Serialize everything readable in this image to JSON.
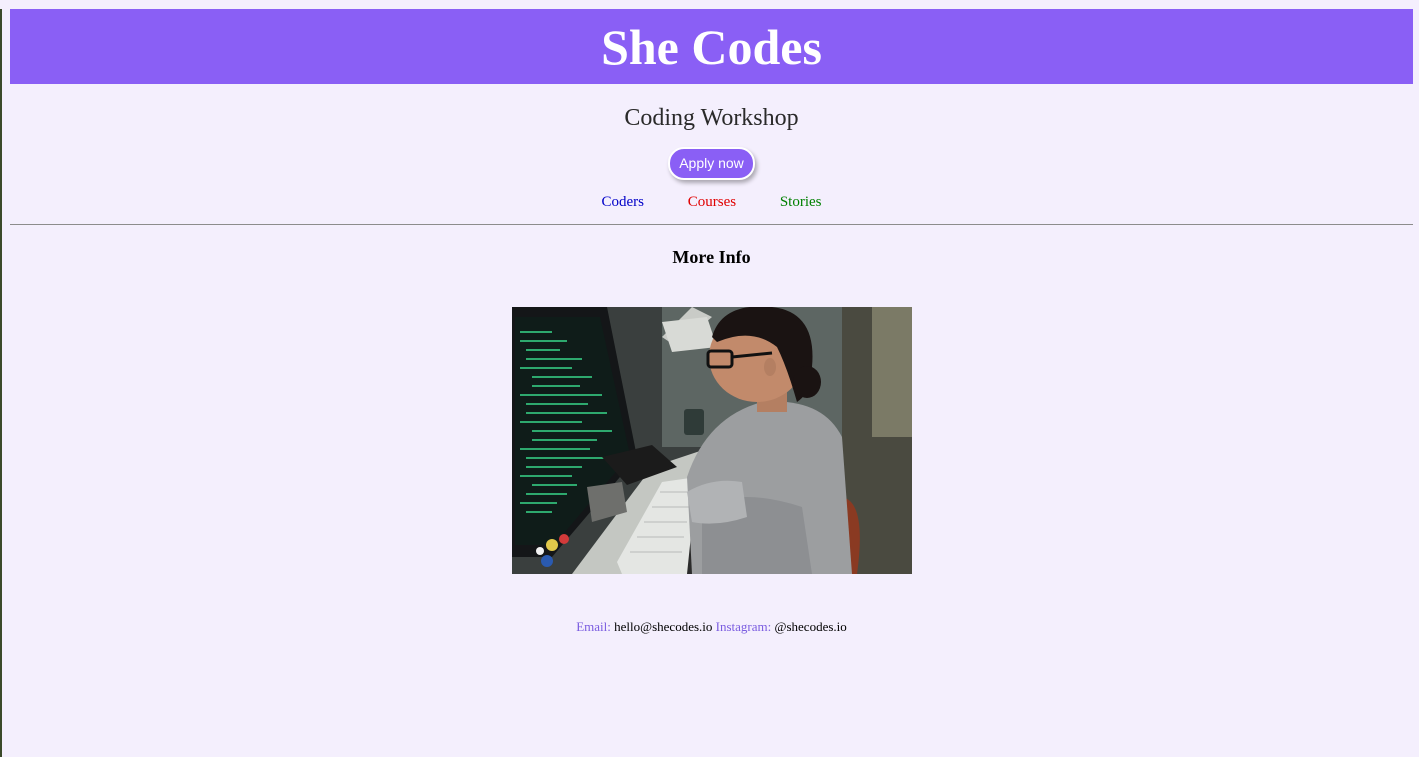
{
  "header": {
    "title": "She Codes",
    "background_color": "#8a5ff5"
  },
  "hero": {
    "subtitle": "Coding Workshop",
    "apply_label": "Apply now"
  },
  "nav": {
    "links": [
      {
        "label": "Coders",
        "color": "#0000c8"
      },
      {
        "label": "Courses",
        "color": "#e00000"
      },
      {
        "label": "Stories",
        "color": "#008000"
      }
    ]
  },
  "section": {
    "heading": "More Info"
  },
  "image": {
    "icon": "woman-coding-photo"
  },
  "footer": {
    "email_label": "Email:",
    "email_value": "hello@shecodes.io",
    "instagram_label": "Instagram:",
    "instagram_value": "@shecodes.io",
    "label_color": "#7a5ce0"
  }
}
